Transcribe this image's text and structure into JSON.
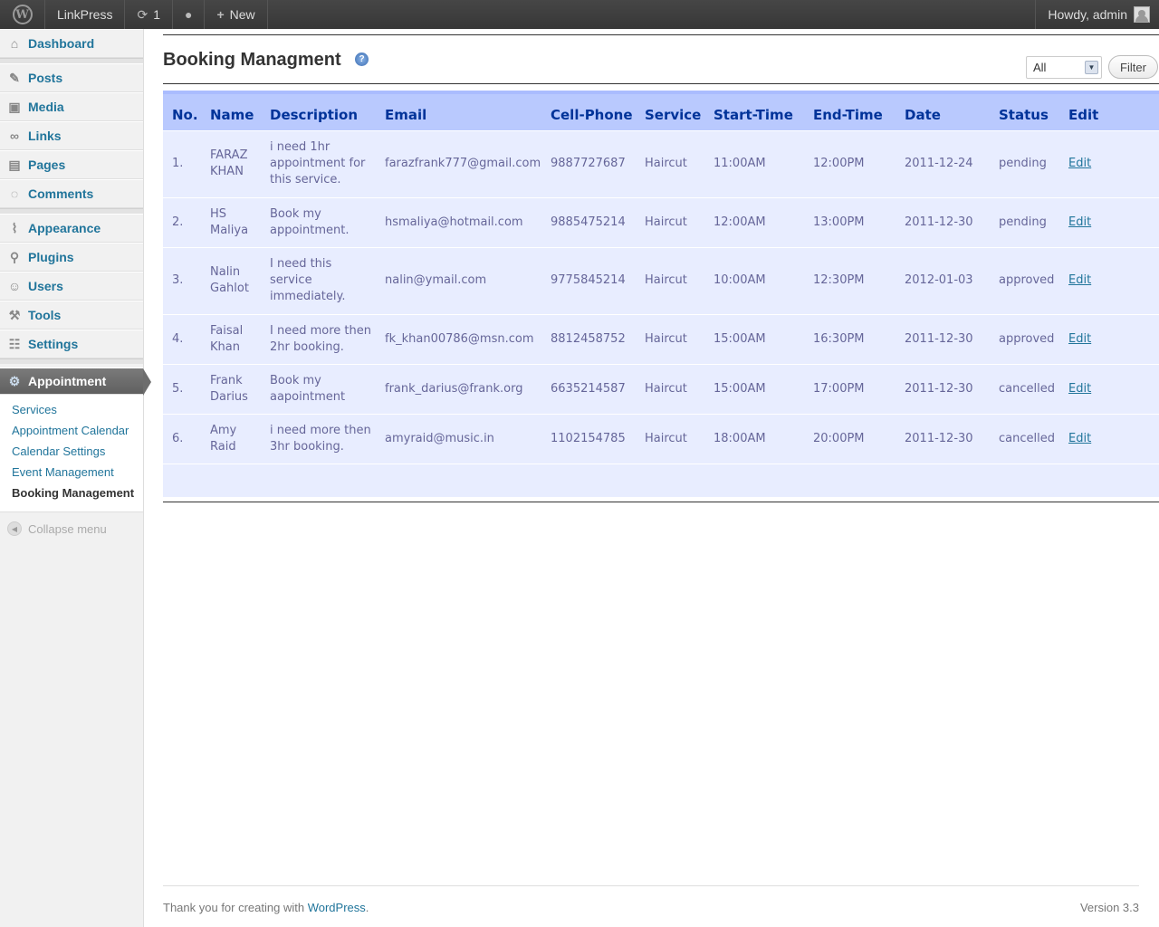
{
  "adminbar": {
    "site_name": "LinkPress",
    "updates_count": "1",
    "new_label": "New",
    "howdy": "Howdy, admin"
  },
  "sidebar": {
    "items": [
      {
        "label": "Dashboard",
        "icon": "dashboard-icon"
      },
      {
        "label": "Posts",
        "icon": "pin-icon"
      },
      {
        "label": "Media",
        "icon": "media-icon"
      },
      {
        "label": "Links",
        "icon": "link-icon"
      },
      {
        "label": "Pages",
        "icon": "pages-icon"
      },
      {
        "label": "Comments",
        "icon": "comment-icon"
      },
      {
        "label": "Appearance",
        "icon": "brush-icon"
      },
      {
        "label": "Plugins",
        "icon": "plug-icon"
      },
      {
        "label": "Users",
        "icon": "users-icon"
      },
      {
        "label": "Tools",
        "icon": "tools-icon"
      },
      {
        "label": "Settings",
        "icon": "settings-icon"
      }
    ],
    "current": {
      "label": "Appointment",
      "icon": "gear-icon"
    },
    "submenu": [
      "Services",
      "Appointment Calendar",
      "Calendar Settings",
      "Event Management",
      "Booking Management"
    ],
    "collapse_label": "Collapse menu"
  },
  "main": {
    "title": "Booking Managment",
    "filter": {
      "selected": "All",
      "button": "Filter"
    },
    "columns": [
      "No.",
      "Name",
      "Description",
      "Email",
      "Cell-Phone",
      "Service",
      "Start-Time",
      "End-Time",
      "Date",
      "Status",
      "Edit"
    ],
    "rows": [
      {
        "no": "1.",
        "name": "FARAZ KHAN",
        "description": "i need 1hr appointment for this service.",
        "email": "farazfrank777@gmail.com",
        "phone": "9887727687",
        "service": "Haircut",
        "start": "11:00AM",
        "end": "12:00PM",
        "date": "2011-12-24",
        "status": "pending",
        "edit": "Edit"
      },
      {
        "no": "2.",
        "name": "HS Maliya",
        "description": "Book my appointment.",
        "email": "hsmaliya@hotmail.com",
        "phone": "9885475214",
        "service": "Haircut",
        "start": "12:00AM",
        "end": "13:00PM",
        "date": "2011-12-30",
        "status": "pending",
        "edit": "Edit"
      },
      {
        "no": "3.",
        "name": "Nalin Gahlot",
        "description": "I need this service immediately.",
        "email": "nalin@ymail.com",
        "phone": "9775845214",
        "service": "Haircut",
        "start": "10:00AM",
        "end": "12:30PM",
        "date": "2012-01-03",
        "status": "approved",
        "edit": "Edit"
      },
      {
        "no": "4.",
        "name": "Faisal Khan",
        "description": "I need more then 2hr booking.",
        "email": "fk_khan00786@msn.com",
        "phone": "8812458752",
        "service": "Haircut",
        "start": "15:00AM",
        "end": "16:30PM",
        "date": "2011-12-30",
        "status": "approved",
        "edit": "Edit"
      },
      {
        "no": "5.",
        "name": "Frank Darius",
        "description": "Book my aapointment",
        "email": "frank_darius@frank.org",
        "phone": "6635214587",
        "service": "Haircut",
        "start": "15:00AM",
        "end": "17:00PM",
        "date": "2011-12-30",
        "status": "cancelled",
        "edit": "Edit"
      },
      {
        "no": "6.",
        "name": "Amy Raid",
        "description": "i need more then 3hr booking.",
        "email": "amyraid@music.in",
        "phone": "1102154785",
        "service": "Haircut",
        "start": "18:00AM",
        "end": "20:00PM",
        "date": "2011-12-30",
        "status": "cancelled",
        "edit": "Edit"
      }
    ]
  },
  "footer": {
    "thanks_prefix": "Thank you for creating with ",
    "wp_link": "WordPress",
    "thanks_suffix": ".",
    "version": "Version 3.3"
  }
}
